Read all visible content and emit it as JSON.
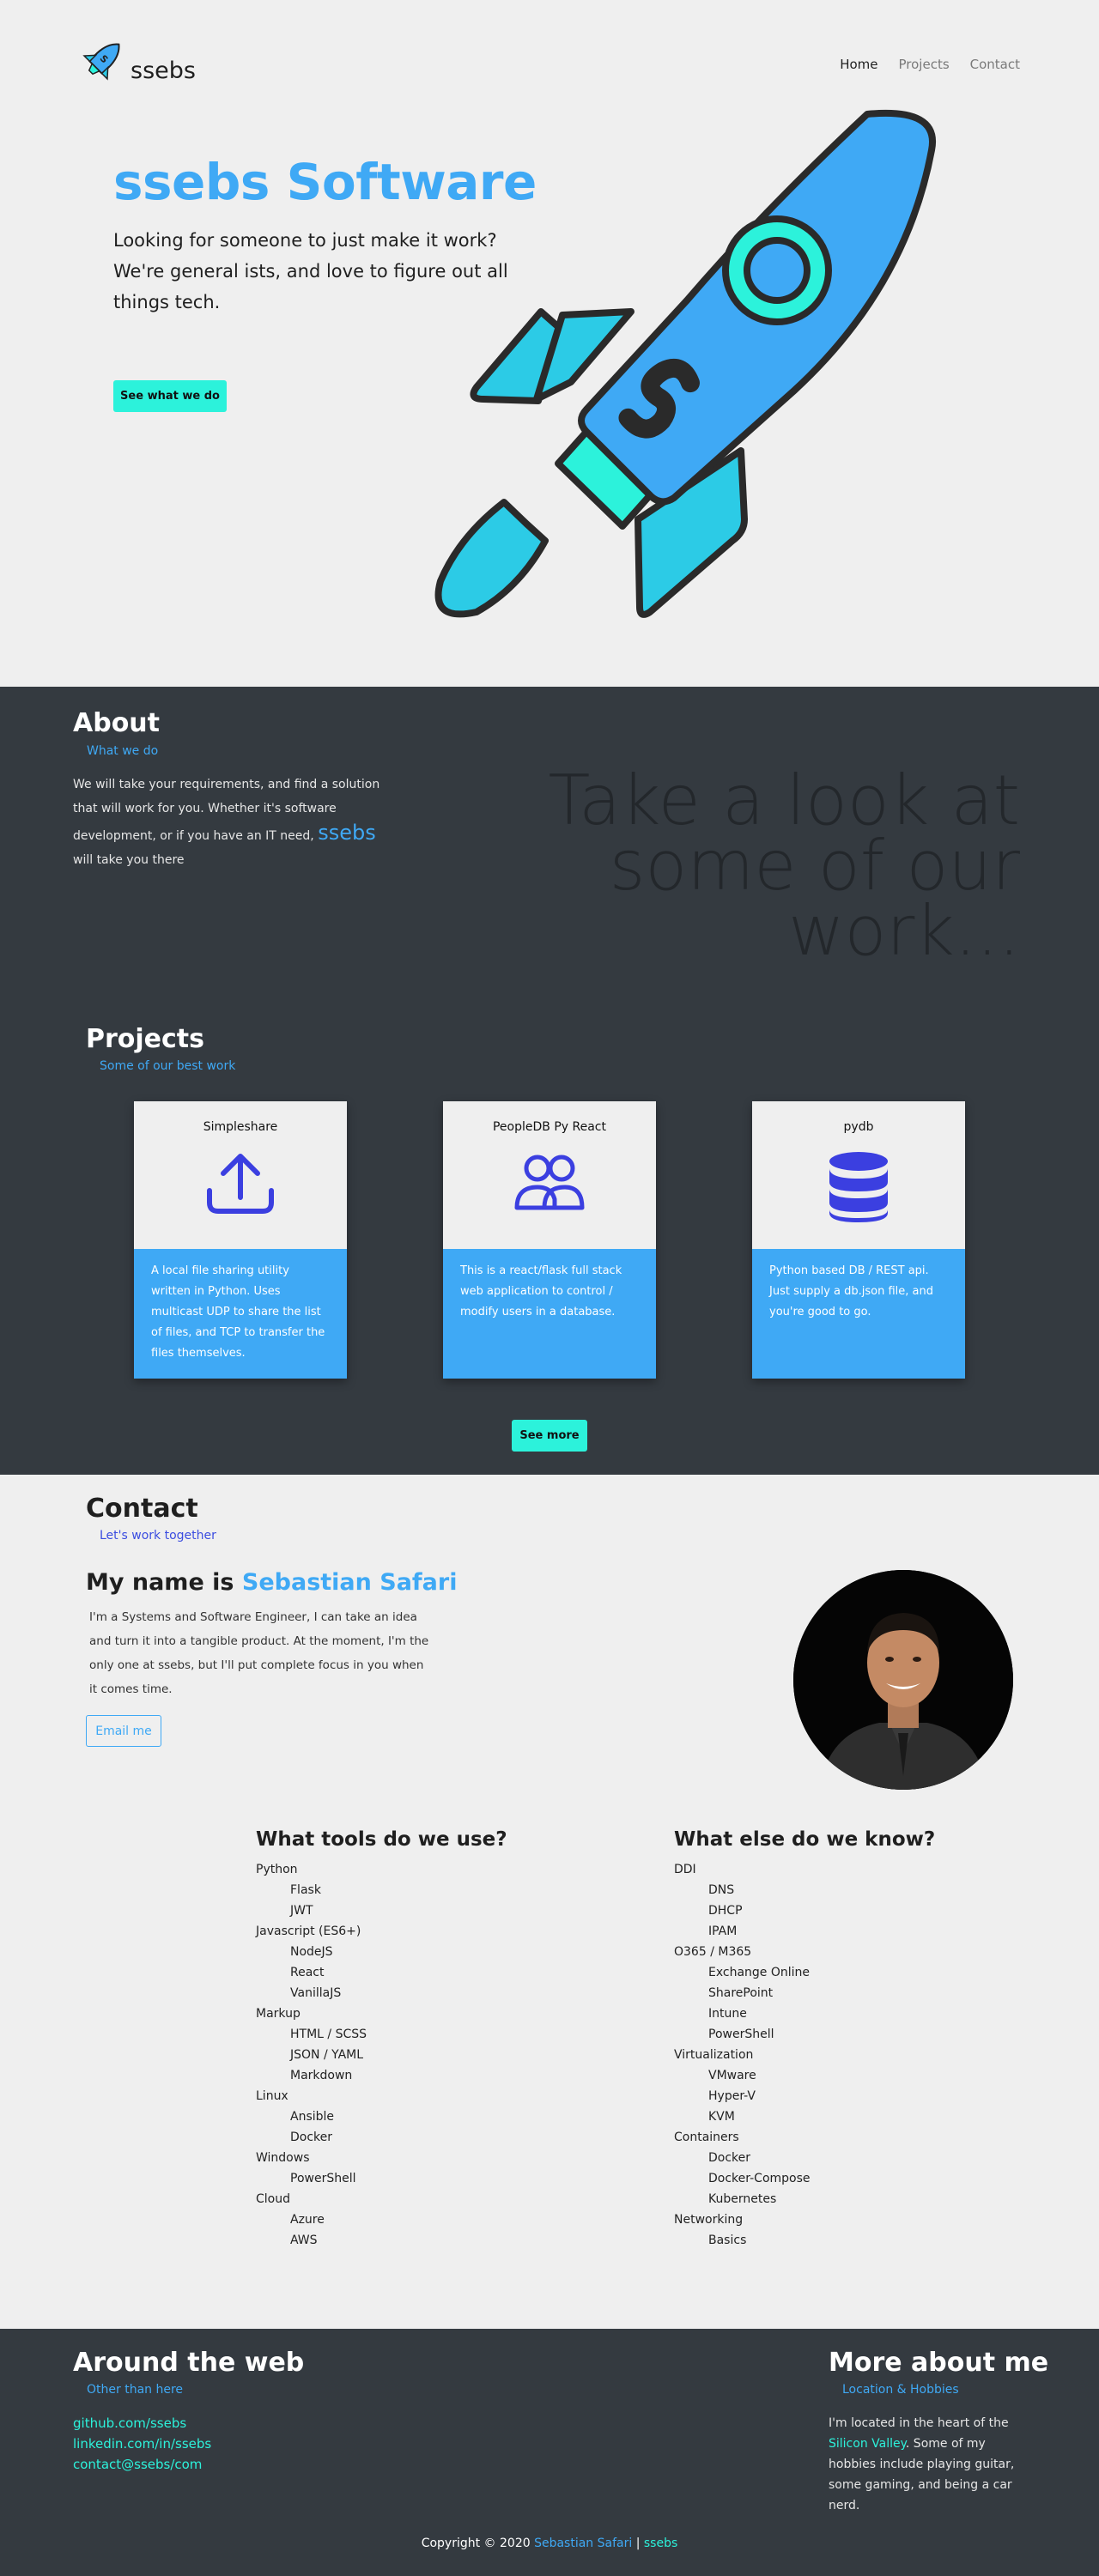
{
  "nav": {
    "logo_text": "ssebs",
    "links": [
      "Home",
      "Projects",
      "Contact"
    ]
  },
  "hero": {
    "title": "ssebs Software",
    "subtitle": "Looking for someone to just make it work? We're general ists, and love to figure out all things tech.",
    "cta_label": "See what we do"
  },
  "about": {
    "title": "About",
    "subtitle": "What we do",
    "body_prefix": "We will take your requirements, and find a solution that will work for you. Whether it's software development, or if you have an IT need,",
    "body_highlight": "ssebs",
    "body_suffix": "will take you there",
    "watermark": "Take a look at some of our work..."
  },
  "projects": {
    "title": "Projects",
    "subtitle": "Some of our best work",
    "items": [
      {
        "name": "Simpleshare",
        "icon": "upload-icon",
        "description": "A local file sharing utility written in Python. Uses multicast UDP to share the list of files, and TCP to transfer the files themselves."
      },
      {
        "name": "PeopleDB Py React",
        "icon": "users-icon",
        "description": "This is a react/flask full stack web application to control / modify users in a database."
      },
      {
        "name": "pydb",
        "icon": "database-icon",
        "description": "Python based DB / REST api. Just supply a db.json file, and you're good to go."
      }
    ],
    "see_more_label": "See more"
  },
  "contact": {
    "title": "Contact",
    "subtitle": "Let's work together",
    "name_prefix": "My name is",
    "name": "Sebastian Safari",
    "body": "I'm a Systems and Software Engineer, I can take an idea and turn it into a tangible product. At the moment, I'm the only one at ssebs, but I'll put complete focus in you when it comes time.",
    "email_label": "Email me"
  },
  "tools": {
    "title": "What tools do we use?",
    "groups": [
      {
        "name": "Python",
        "items": [
          "Flask",
          "JWT"
        ]
      },
      {
        "name": "Javascript (ES6+)",
        "items": [
          "NodeJS",
          "React",
          "VanillaJS"
        ]
      },
      {
        "name": "Markup",
        "items": [
          "HTML / SCSS",
          "JSON / YAML",
          "Markdown"
        ]
      },
      {
        "name": "Linux",
        "items": [
          "Ansible",
          "Docker"
        ]
      },
      {
        "name": "Windows",
        "items": [
          "PowerShell"
        ]
      },
      {
        "name": "Cloud",
        "items": [
          "Azure",
          "AWS"
        ]
      }
    ]
  },
  "knowledge": {
    "title": "What else do we know?",
    "groups": [
      {
        "name": "DDI",
        "items": [
          "DNS",
          "DHCP",
          "IPAM"
        ]
      },
      {
        "name": "O365 / M365",
        "items": [
          "Exchange Online",
          "SharePoint",
          "Intune",
          "PowerShell"
        ]
      },
      {
        "name": "Virtualization",
        "items": [
          "VMware",
          "Hyper-V",
          "KVM"
        ]
      },
      {
        "name": "Containers",
        "items": [
          "Docker",
          "Docker-Compose",
          "Kubernetes"
        ]
      },
      {
        "name": "Networking",
        "items": [
          "Basics"
        ]
      }
    ]
  },
  "footer": {
    "left_title": "Around the web",
    "left_subtitle": "Other than here",
    "links": [
      "github.com/ssebs",
      "linkedin.com/in/ssebs",
      "contact@ssebs/com"
    ],
    "right_title": "More about me",
    "right_subtitle": "Location & Hobbies",
    "right_body_prefix": "I'm located in the heart of the",
    "right_body_highlight": "Silicon Valley",
    "right_body_suffix": ". Some of my hobbies include playing guitar, some gaming, and being a car nerd.",
    "copyright_prefix": "Copyright © 2020",
    "copyright_name": "Sebastian Safari",
    "copyright_sep": "|",
    "copyright_brand": "ssebs"
  },
  "colors": {
    "accent_blue": "#3fa9f5",
    "accent_aqua": "#2cf2db",
    "dark_bg": "#343a40",
    "light_bg": "#efefef",
    "icon_indigo": "#3b3fe0"
  }
}
